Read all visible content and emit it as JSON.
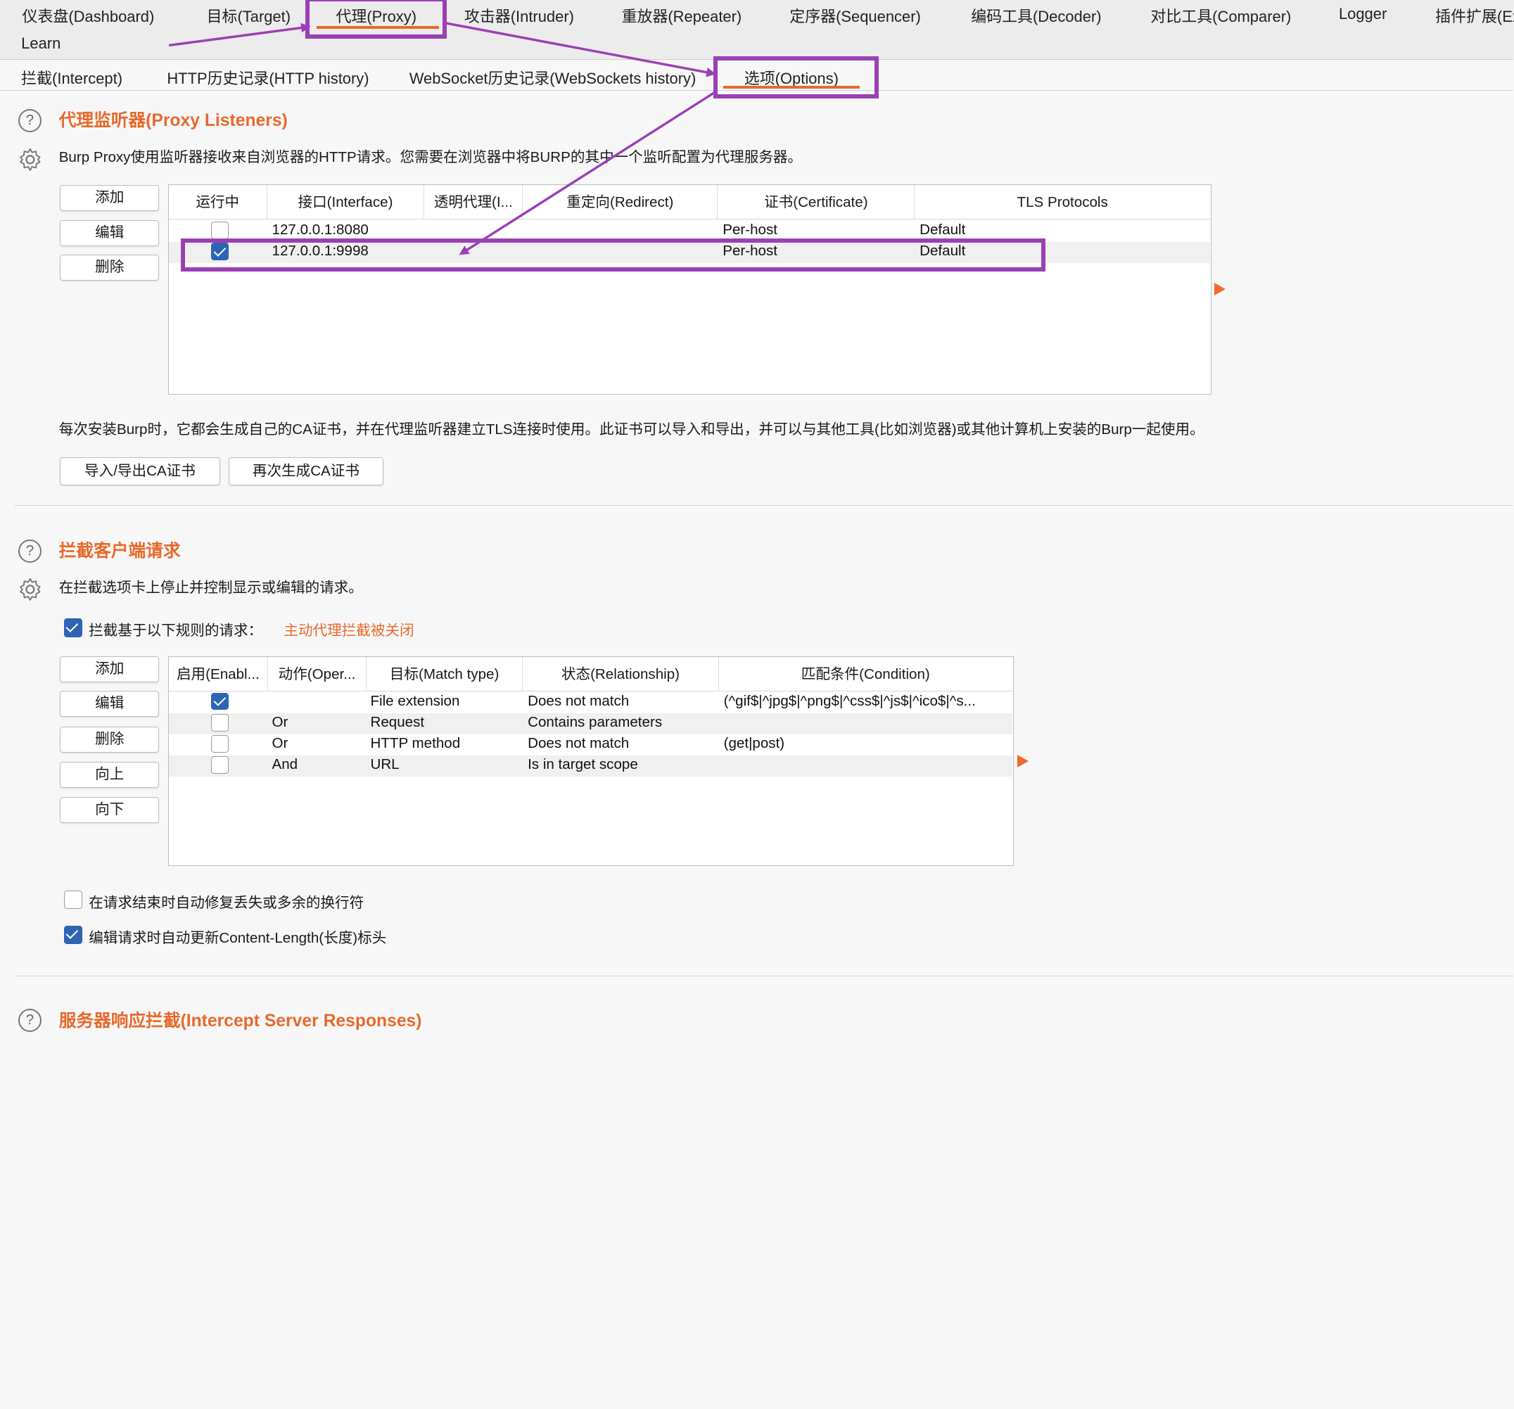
{
  "top_tabs": {
    "dashboard": "仪表盘(Dashboard)",
    "target": "目标(Target)",
    "proxy": "代理(Proxy)",
    "intruder": "攻击器(Intruder)",
    "repeater": "重放器(Repeater)",
    "sequencer": "定序器(Sequencer)",
    "decoder": "编码工具(Decoder)",
    "comparer": "对比工具(Comparer)",
    "logger": "Logger",
    "extender": "插件扩展(Ex",
    "learn": "Learn"
  },
  "sub_tabs": {
    "intercept": "拦截(Intercept)",
    "http_history": "HTTP历史记录(HTTP history)",
    "websocket_history": "WebSocket历史记录(WebSockets history)",
    "options": "选项(Options)"
  },
  "colors": {
    "accent": "#e8692c",
    "highlight": "#9b3fb5",
    "checkbox": "#2e64b5"
  },
  "listeners": {
    "title": "代理监听器(Proxy Listeners)",
    "description": "Burp Proxy使用监听器接收来自浏览器的HTTP请求。您需要在浏览器中将BURP的其中一个监听配置为代理服务器。",
    "buttons": {
      "add": "添加",
      "edit": "编辑",
      "remove": "删除"
    },
    "columns": [
      "运行中",
      "接口(Interface)",
      "透明代理(I...",
      "重定向(Redirect)",
      "证书(Certificate)",
      "TLS Protocols"
    ],
    "rows": [
      {
        "running": false,
        "interface": "127.0.0.1:8080",
        "invisible": "",
        "redirect": "",
        "certificate": "Per-host",
        "tls": "Default"
      },
      {
        "running": true,
        "interface": "127.0.0.1:9998",
        "invisible": "",
        "redirect": "",
        "certificate": "Per-host",
        "tls": "Default"
      }
    ],
    "ca_note": "每次安装Burp时，它都会生成自己的CA证书，并在代理监听器建立TLS连接时使用。此证书可以导入和导出，并可以与其他工具(比如浏览器)或其他计算机上安装的Burp一起使用。",
    "ca_buttons": {
      "import_export": "导入/导出CA证书",
      "regenerate": "再次生成CA证书"
    }
  },
  "intercept_client": {
    "title": "拦截客户端请求",
    "description": "在拦截选项卡上停止并控制显示或编辑的请求。",
    "rule_checkbox_label": "拦截基于以下规则的请求：",
    "rule_checkbox_checked": true,
    "status_note": "主动代理拦截被关闭",
    "buttons": {
      "add": "添加",
      "edit": "编辑",
      "remove": "删除",
      "up": "向上",
      "down": "向下"
    },
    "columns": [
      "启用(Enabl...",
      "动作(Oper...",
      "目标(Match type)",
      "状态(Relationship)",
      "匹配条件(Condition)"
    ],
    "rows": [
      {
        "enabled": true,
        "operator": "",
        "match_type": "File extension",
        "relationship": "Does not match",
        "condition": "(^gif$|^jpg$|^png$|^css$|^js$|^ico$|^s..."
      },
      {
        "enabled": false,
        "operator": "Or",
        "match_type": "Request",
        "relationship": "Contains parameters",
        "condition": ""
      },
      {
        "enabled": false,
        "operator": "Or",
        "match_type": "HTTP method",
        "relationship": "Does not match",
        "condition": "(get|post)"
      },
      {
        "enabled": false,
        "operator": "And",
        "match_type": "URL",
        "relationship": "Is in target scope",
        "condition": ""
      }
    ],
    "fix_newlines_label": "在请求结束时自动修复丢失或多余的换行符",
    "fix_newlines_checked": false,
    "update_length_label": "编辑请求时自动更新Content-Length(长度)标头",
    "update_length_checked": true
  },
  "intercept_server": {
    "title": "服务器响应拦截(Intercept Server Responses)"
  }
}
